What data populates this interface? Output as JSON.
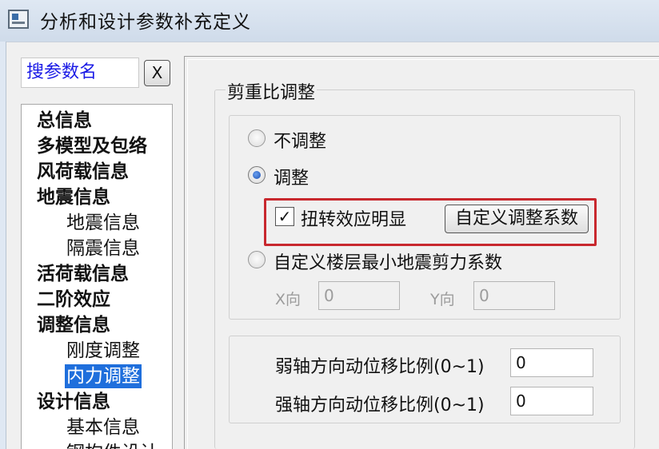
{
  "window": {
    "title": "分析和设计参数补充定义"
  },
  "search": {
    "value": "搜参数名",
    "clear_label": "X"
  },
  "nav": {
    "items": [
      {
        "label": "总信息",
        "level": 0
      },
      {
        "label": "多模型及包络",
        "level": 0
      },
      {
        "label": "风荷载信息",
        "level": 0
      },
      {
        "label": "地震信息",
        "level": 0
      },
      {
        "label": "地震信息",
        "level": 1
      },
      {
        "label": "隔震信息",
        "level": 1
      },
      {
        "label": "活荷载信息",
        "level": 0
      },
      {
        "label": "二阶效应",
        "level": 0
      },
      {
        "label": "调整信息",
        "level": 0
      },
      {
        "label": "刚度调整",
        "level": 1
      },
      {
        "label": "内力调整",
        "level": 1,
        "selected": true
      },
      {
        "label": "设计信息",
        "level": 0
      },
      {
        "label": "基本信息",
        "level": 1
      },
      {
        "label": "钢构件设计",
        "level": 1
      }
    ]
  },
  "shear_ratio_group": {
    "title": "剪重比调整",
    "options": {
      "no_adjust": "不调整",
      "adjust": "调整",
      "custom_floor": "自定义楼层最小地震剪力系数"
    },
    "selected": "adjust",
    "torsion_checkbox": {
      "label": "扭转效应明显",
      "checked": true
    },
    "custom_coef_button": "自定义调整系数",
    "x_label": "X向",
    "x_value": "0",
    "y_label": "Y向",
    "y_value": "0"
  },
  "ratio_group": {
    "weak_label": "弱轴方向动位移比例(0~1)",
    "weak_value": "0",
    "strong_label": "强轴方向动位移比例(0~1)",
    "strong_value": "0"
  },
  "colors": {
    "highlight": "#c8282e",
    "selection": "#1f6fdc",
    "search_text": "#1a1ae6"
  }
}
